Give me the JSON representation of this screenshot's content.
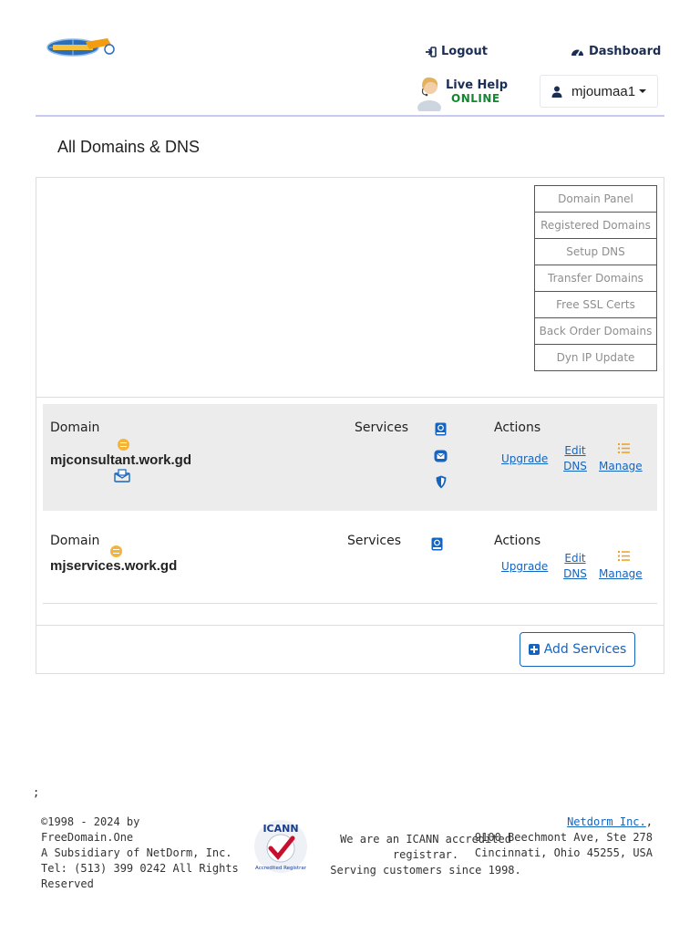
{
  "header": {
    "logout_label": "Logout",
    "dashboard_label": "Dashboard",
    "live_help": {
      "title": "Live Help",
      "status": "ONLINE"
    },
    "user": {
      "name": "mjoumaa1"
    }
  },
  "page_title": "All Domains & DNS",
  "side_menu": {
    "items": [
      {
        "label": "Domain Panel"
      },
      {
        "label": "Registered Domains"
      },
      {
        "label": "Setup DNS"
      },
      {
        "label": "Transfer Domains"
      },
      {
        "label": "Free SSL Certs"
      },
      {
        "label": "Back Order Domains"
      },
      {
        "label": "Dyn IP Update"
      }
    ]
  },
  "domains": [
    {
      "domain_label": "Domain",
      "name": "mjconsultant.work.gd",
      "services_label": "Services",
      "services": [
        "book-icon",
        "email-icon",
        "shield-icon"
      ],
      "actions_label": "Actions",
      "upgrade": "Upgrade",
      "edit_dns": "Edit DNS",
      "manage": "Manage"
    },
    {
      "domain_label": "Domain",
      "name": "mjservices.work.gd",
      "services_label": "Services",
      "services": [
        "book-icon"
      ],
      "actions_label": "Actions",
      "upgrade": "Upgrade",
      "edit_dns": "Edit DNS",
      "manage": "Manage"
    }
  ],
  "add_services_label": "Add Services",
  "footer": {
    "stray_mark": ";",
    "left_lines": [
      "©1998 - 2024 by",
      "FreeDomain.One",
      "A Subsidiary of NetDorm, Inc.",
      "Tel: (513) 399 0242 All Rights",
      "Reserved"
    ],
    "center_lines": [
      "We are an ICANN accredited registrar.",
      "Serving customers since 1998."
    ],
    "right_link": "Netdorm Inc.",
    "right_lines": [
      "9100 Beechmont Ave, Ste 278",
      "Cincinnati, Ohio 45255, USA"
    ],
    "icann_seal_text": "ICANN Accredited Registrar"
  },
  "colors": {
    "link_blue": "#1565c0",
    "nav_text": "#1a2e55",
    "online_green": "#12872f",
    "status_orange": "#f4b43a",
    "header_rule": "#c8c9ef"
  }
}
